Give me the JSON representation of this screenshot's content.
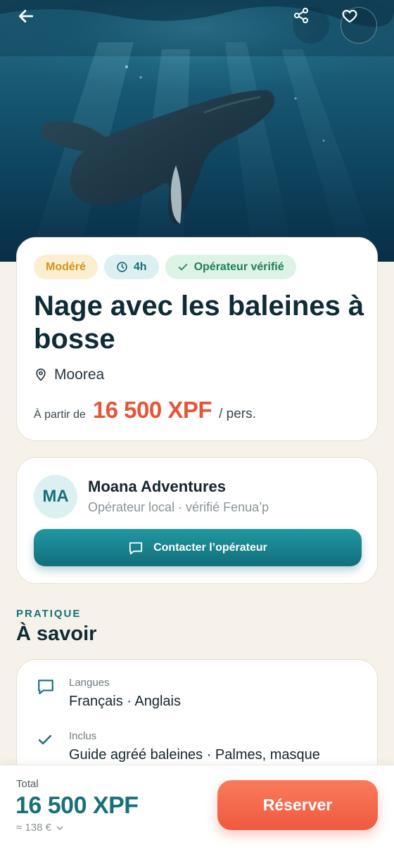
{
  "colors": {
    "accent_teal": "#16707a",
    "price_red": "#e55537",
    "reserve_orange": "#ef5a3e",
    "background": "#f6f2ea"
  },
  "hero": {
    "image": "humpback-whale-underwater",
    "icons": [
      "arrow-left-icon",
      "share-icon",
      "heart-icon"
    ]
  },
  "activity": {
    "chips": {
      "difficulty": "Modéré",
      "duration": "4h",
      "verified": "Opérateur vérifié"
    },
    "title": "Nage avec les baleines à bosse",
    "location": "Moorea",
    "price_prefix": "À partir de",
    "price": "16 500 XPF",
    "price_suffix": "/ pers."
  },
  "operator": {
    "initials": "MA",
    "name": "Moana Adventures",
    "subtitle": "Opérateur local · vérifié Fenua’p",
    "contact_label": "Contacter l’opérateur"
  },
  "section": {
    "kicker": "PRATIQUE",
    "title": "À savoir"
  },
  "info": [
    {
      "icon": "chat-icon",
      "label": "Langues",
      "value": "Français · Anglais"
    },
    {
      "icon": "check-icon",
      "label": "Inclus",
      "value": "Guide agréé baleines · Palmes, masque"
    }
  ],
  "footer": {
    "total_label": "Total",
    "total_price": "16 500 XPF",
    "total_eur": "≈ 138 €",
    "reserve_label": "Réserver"
  }
}
